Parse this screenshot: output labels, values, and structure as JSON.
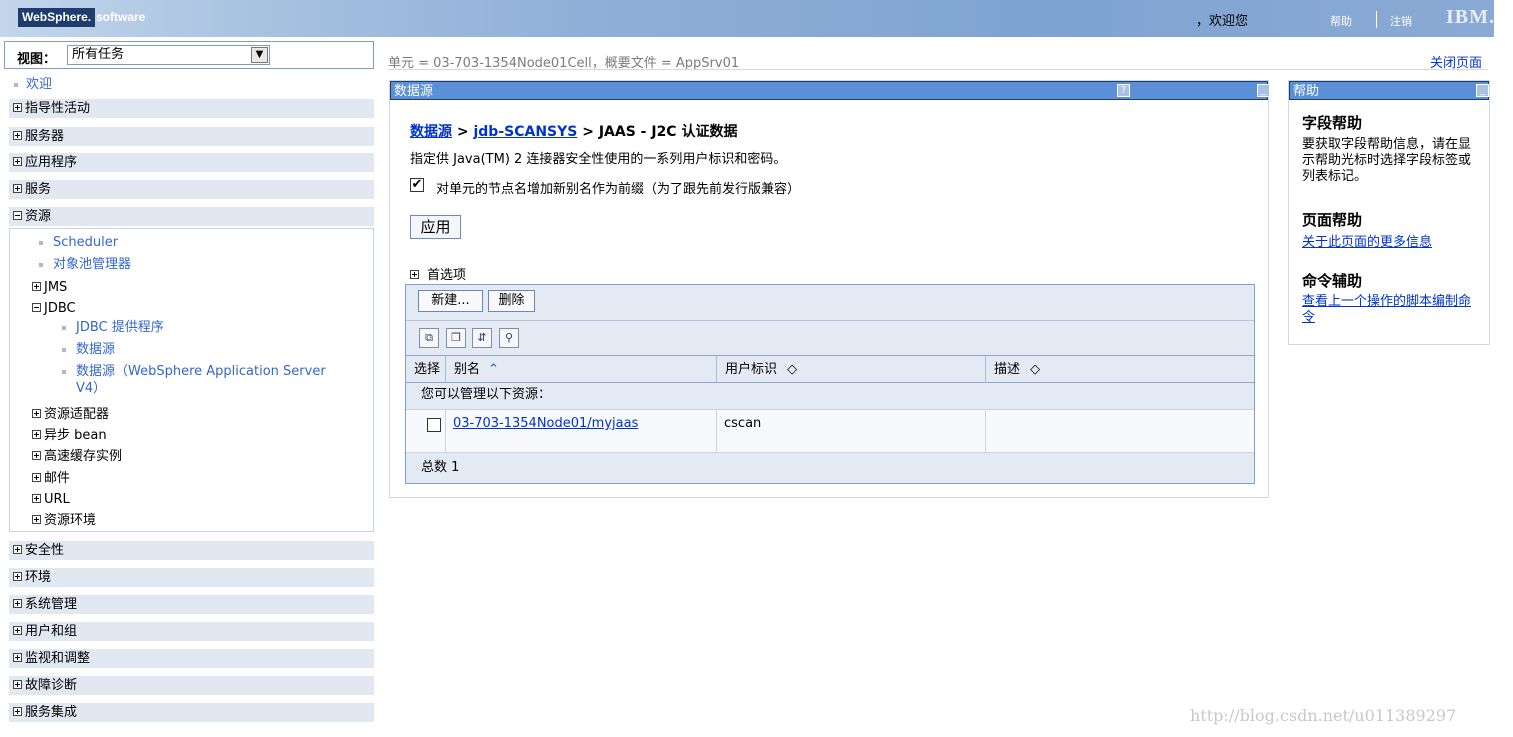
{
  "banner": {
    "logo_brand": "WebSphere.",
    "logo_product": "software",
    "welcome": "，欢迎您",
    "help": "帮助",
    "logout": "注销",
    "ibm": "IBM."
  },
  "nav": {
    "view_label": "视图：",
    "view_value": "所有任务",
    "welcome": "欢迎",
    "categories_top": [
      {
        "label": "指导性活动",
        "expanded": false
      },
      {
        "label": "服务器",
        "expanded": false
      },
      {
        "label": "应用程序",
        "expanded": false
      },
      {
        "label": "服务",
        "expanded": false
      },
      {
        "label": "资源",
        "expanded": true
      }
    ],
    "resources": {
      "scheduler": "Scheduler",
      "object_pool": "对象池管理器",
      "jms": "JMS",
      "jdbc": "JDBC",
      "jdbc_provider": "JDBC 提供程序",
      "datasource": "数据源",
      "datasource_v4_line1": "数据源（WebSphere Application Server",
      "datasource_v4_line2": "V4）",
      "adapters": "资源适配器",
      "async_bean": "异步 bean",
      "cache": "高速缓存实例",
      "mail": "邮件",
      "url": "URL",
      "env": "资源环境"
    },
    "categories_bottom": [
      {
        "label": "安全性"
      },
      {
        "label": "环境"
      },
      {
        "label": "系统管理"
      },
      {
        "label": "用户和组"
      },
      {
        "label": "监视和调整"
      },
      {
        "label": "故障诊断"
      },
      {
        "label": "服务集成"
      }
    ]
  },
  "header": {
    "cell_info": "单元 = 03-703-1354Node01Cell，概要文件 = AppSrv01",
    "close_page": "关闭页面"
  },
  "main": {
    "panel_title": "数据源",
    "crumb_1": "数据源",
    "crumb_sep": " > ",
    "crumb_2": "jdb-SCANSYS",
    "crumb_3": " > JAAS - J2C 认证数据",
    "description": "指定供 Java(TM) 2 连接器安全性使用的一系列用户标识和密码。",
    "prefix_checked": true,
    "prefix_label": "对单元的节点名增加新别名作为前缀（为了跟先前发行版兼容）",
    "apply": "应用",
    "preferences": "首选项",
    "new_button": "新建...",
    "delete_button": "删除",
    "table": {
      "col_select": "选择",
      "col_alias": "别名",
      "col_user": "用户标识",
      "col_desc": "描述",
      "manage_text": "您可以管理以下资源：",
      "rows": [
        {
          "alias": "03-703-1354Node01/myjaas",
          "user": "cscan",
          "description": ""
        }
      ],
      "total": "总数 1"
    }
  },
  "help": {
    "panel_title": "帮助",
    "field_help_title": "字段帮助",
    "field_help_text": "要获取字段帮助信息，请在显示帮助光标时选择字段标签或列表标记。",
    "page_help_title": "页面帮助",
    "page_help_link": "关于此页面的更多信息",
    "cmd_title": "命令辅助",
    "cmd_link": "查看上一个操作的脚本编制命令"
  },
  "watermark": "http://blog.csdn.net/u011389297"
}
